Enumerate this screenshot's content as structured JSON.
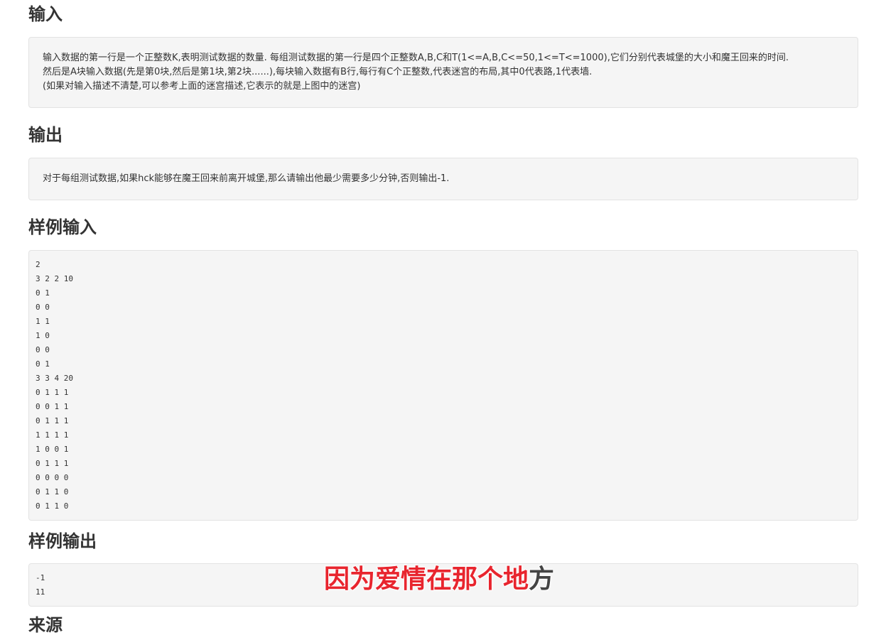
{
  "sections": {
    "input": {
      "heading": "输入",
      "lines": [
        "输入数据的第一行是一个正整数K,表明测试数据的数量. 每组测试数据的第一行是四个正整数A,B,C和T(1<=A,B,C<=50,1<=T<=1000),它们分别代表城堡的大小和魔王回来的时间.",
        "然后是A块输入数据(先是第0块,然后是第1块,第2块......),每块输入数据有B行,每行有C个正整数,代表迷宫的布局,其中0代表路,1代表墙.",
        "(如果对输入描述不清楚,可以参考上面的迷宫描述,它表示的就是上图中的迷宫)"
      ]
    },
    "output": {
      "heading": "输出",
      "lines": [
        "对于每组测试数据,如果hck能够在魔王回来前离开城堡,那么请输出他最少需要多少分钟,否则输出-1."
      ]
    },
    "sample_input": {
      "heading": "样例输入",
      "text": "2\n3 2 2 10\n0 1\n0 0\n1 1\n1 0\n0 0\n0 1\n3 3 4 20\n0 1 1 1\n0 0 1 1\n0 1 1 1\n1 1 1 1\n1 0 0 1\n0 1 1 1\n0 0 0 0\n0 1 1 0\n0 1 1 0"
    },
    "sample_output": {
      "heading": "样例输出",
      "text": "-1\n11"
    },
    "next": {
      "heading": "来源"
    }
  },
  "subtitle": {
    "highlighted": "因为爱情在那个地",
    "rest": "方",
    "highlight_color": "#e8252e",
    "rest_color": "#444444"
  }
}
